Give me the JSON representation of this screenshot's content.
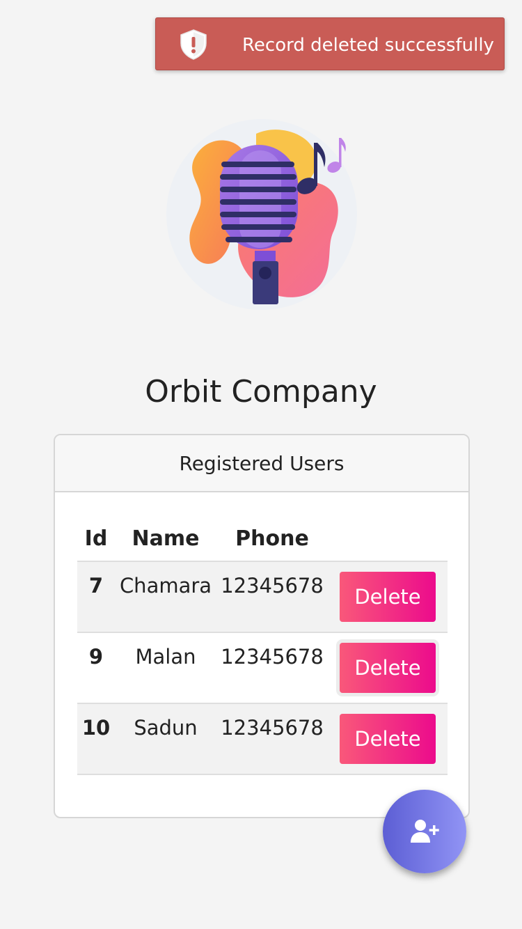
{
  "toast": {
    "message": "Record deleted successfully",
    "icon": "shield-alert-icon",
    "background_color": "#c95c56"
  },
  "logo": {
    "icon": "microphone-music-icon"
  },
  "company": {
    "title": "Orbit Company"
  },
  "users_card": {
    "header": "Registered Users",
    "columns": [
      "Id",
      "Name",
      "Phone",
      ""
    ],
    "rows": [
      {
        "id": "7",
        "name": "Chamara",
        "phone": "12345678",
        "action": "Delete"
      },
      {
        "id": "9",
        "name": "Malan",
        "phone": "12345678",
        "action": "Delete"
      },
      {
        "id": "10",
        "name": "Sadun",
        "phone": "12345678",
        "action": "Delete"
      }
    ]
  },
  "fab": {
    "icon": "add-user-icon",
    "colors": [
      "#5c5ed4",
      "#9194f5"
    ]
  },
  "colors": {
    "delete_gradient": [
      "#f9587a",
      "#ec0b8c"
    ],
    "page_background": "#f4f4f4"
  }
}
